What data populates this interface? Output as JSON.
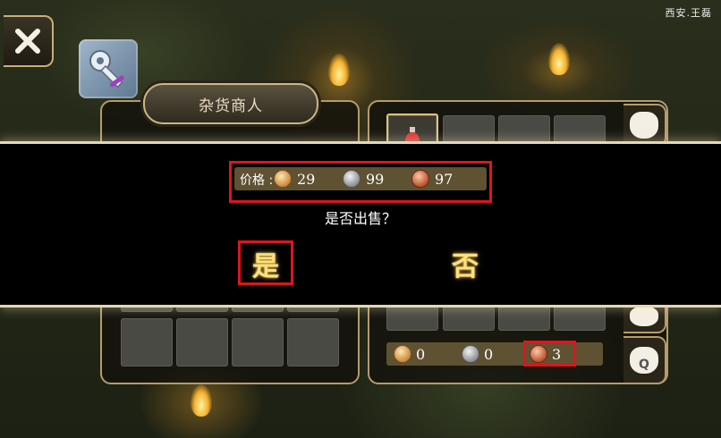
{
  "watermark": "西安.王磊",
  "merchant_title": "杂货商人",
  "icons": {
    "close": "close-x-icon",
    "repair": "key-wrench-icon",
    "bag": "money-bag-icon",
    "quest_bag": "quest-bag-icon"
  },
  "quest_bag_letter": "Q",
  "player_money": {
    "gold": "0",
    "silver": "0",
    "copper": "3"
  },
  "dialog": {
    "price_label": "价格 :",
    "price": {
      "gold": "29",
      "silver": "99",
      "copper": "97"
    },
    "question": "是否出售？",
    "yes_label": "是",
    "no_label": "否"
  },
  "colors": {
    "highlight_box": "#e0141c",
    "choice_text": "#ffe07a",
    "panel_border": "#b59c6a"
  }
}
